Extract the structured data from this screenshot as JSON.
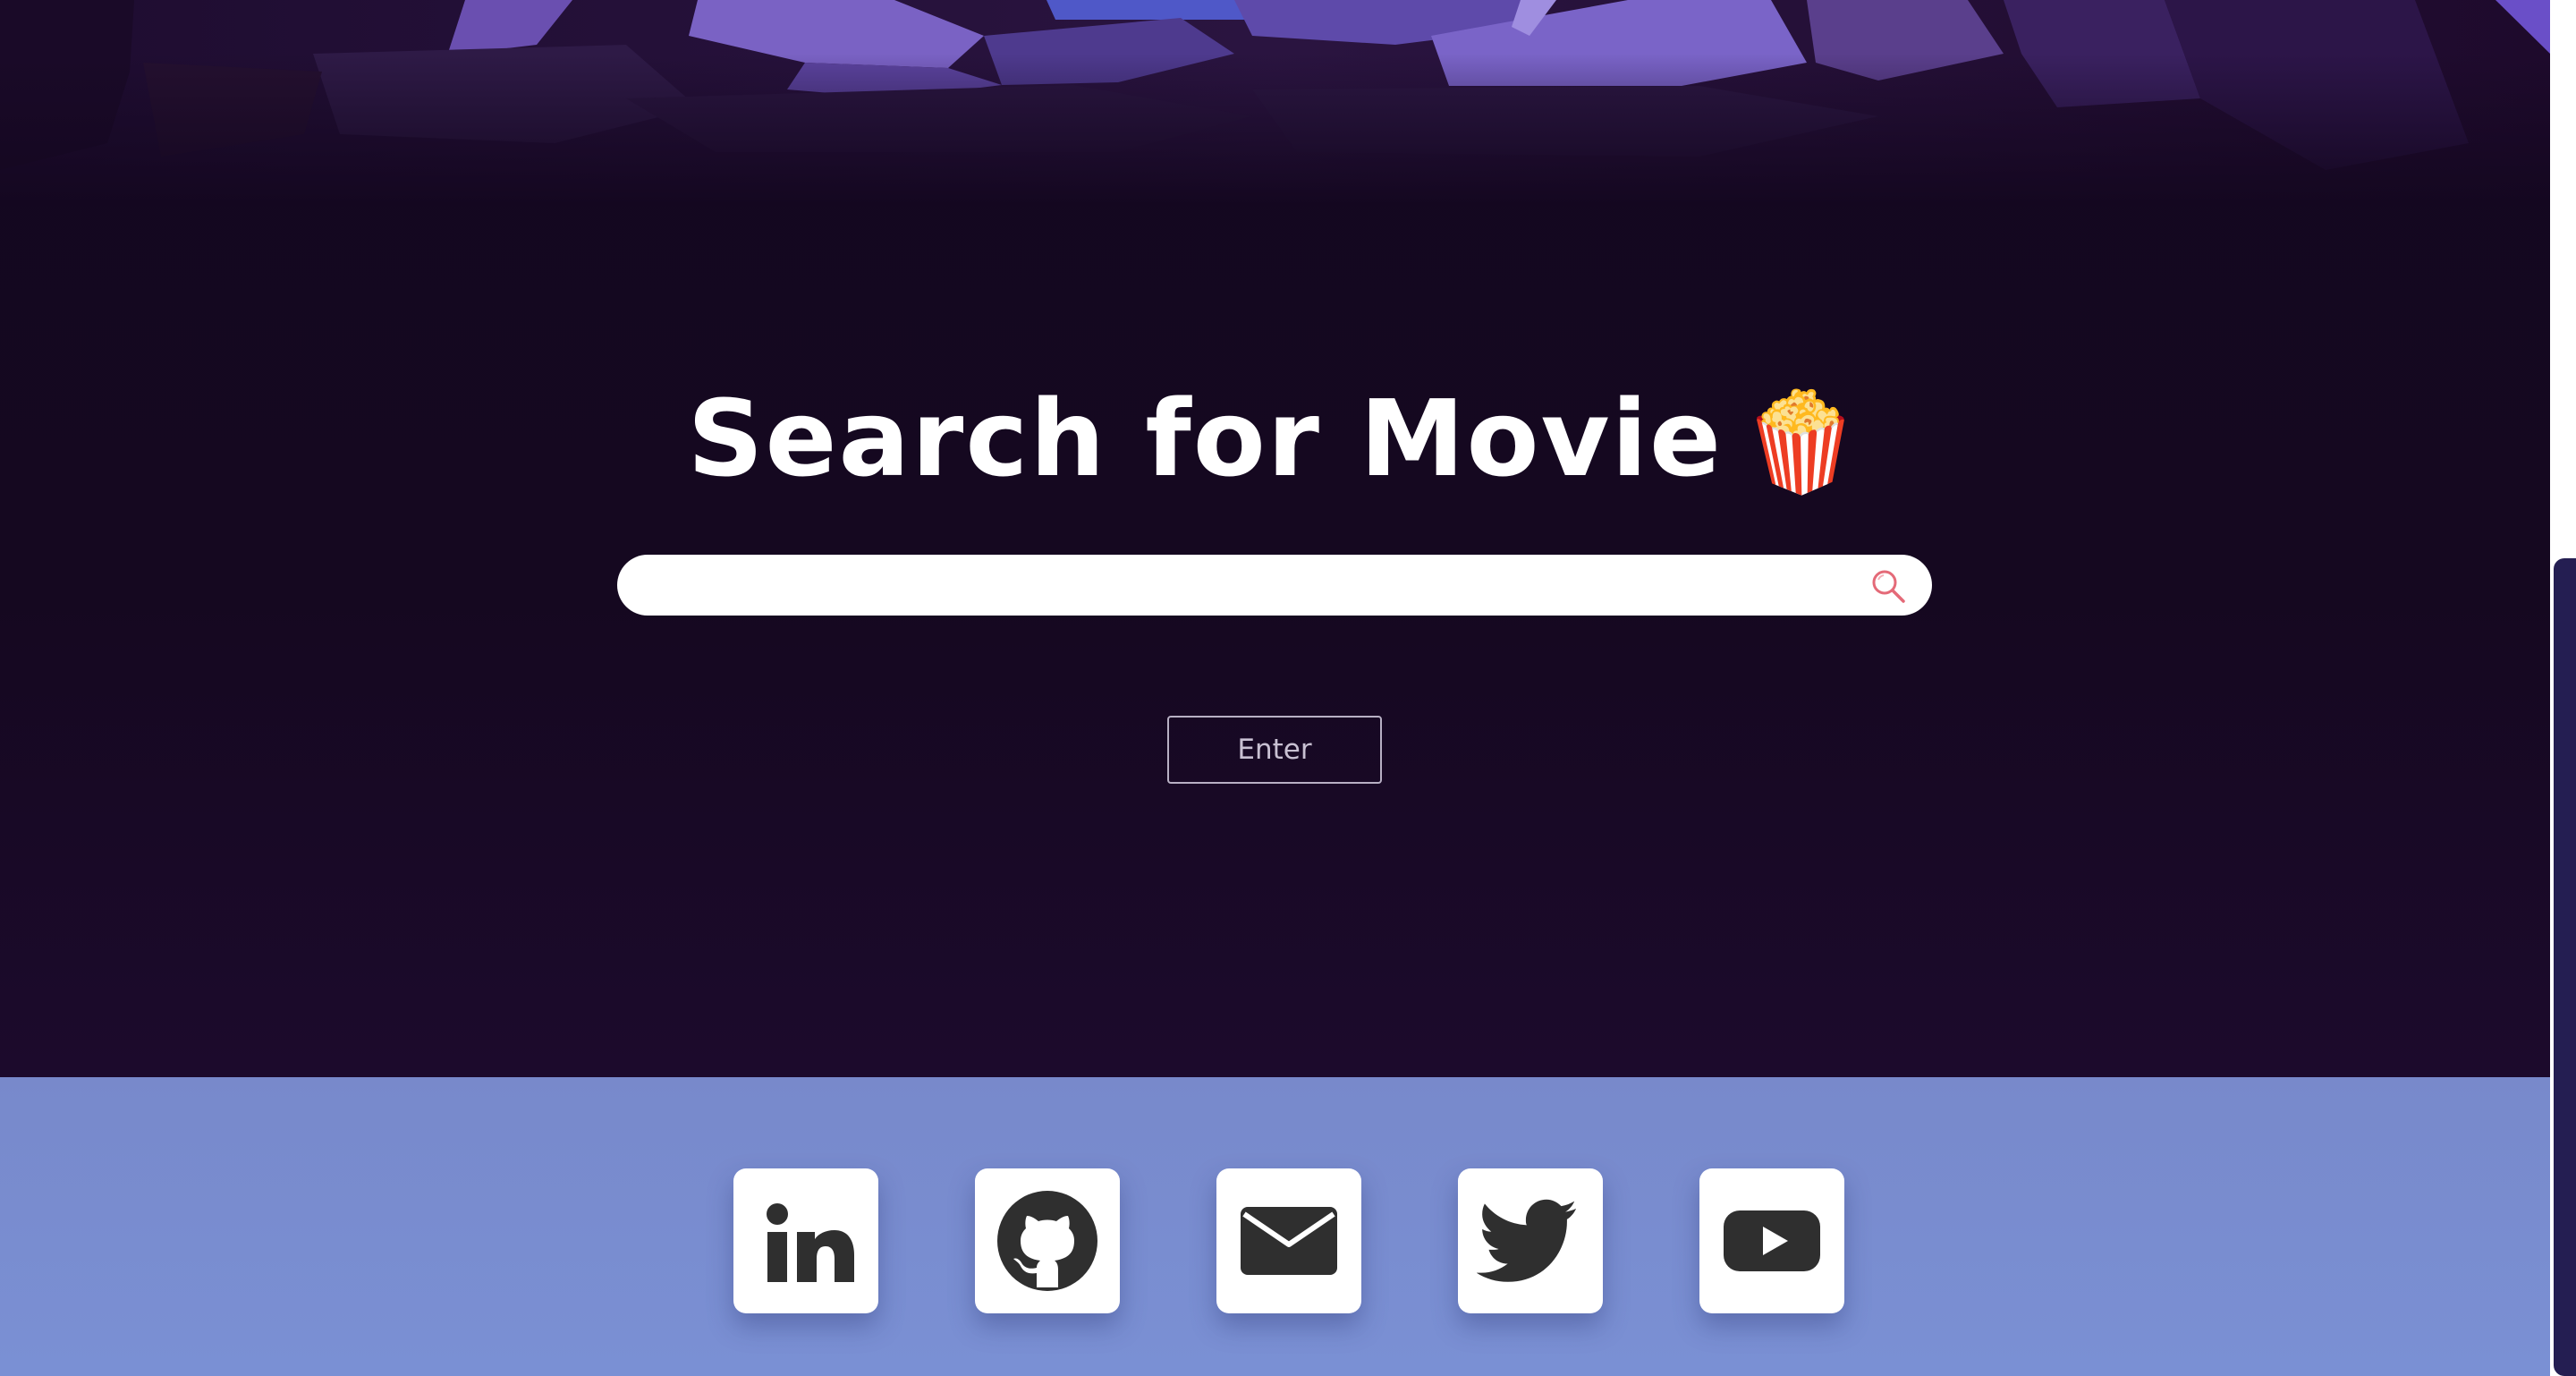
{
  "page": {
    "heading": "Search for Movie",
    "heading_emoji": "🍿"
  },
  "search": {
    "value": "",
    "placeholder": "",
    "icon": "search-icon"
  },
  "enter_button": {
    "label": "Enter"
  },
  "footer": {
    "social_links": [
      {
        "name": "linkedin",
        "icon": "linkedin-icon"
      },
      {
        "name": "github",
        "icon": "github-icon"
      },
      {
        "name": "email",
        "icon": "envelope-icon"
      },
      {
        "name": "twitter",
        "icon": "twitter-icon"
      },
      {
        "name": "youtube",
        "icon": "youtube-icon"
      }
    ]
  },
  "colors": {
    "background": "#140720",
    "footer": "#7a8ed2",
    "accent_search_icon": "#e46a78",
    "icon_fill": "#2f2f2f",
    "scrollbar_thumb": "#241e52"
  }
}
